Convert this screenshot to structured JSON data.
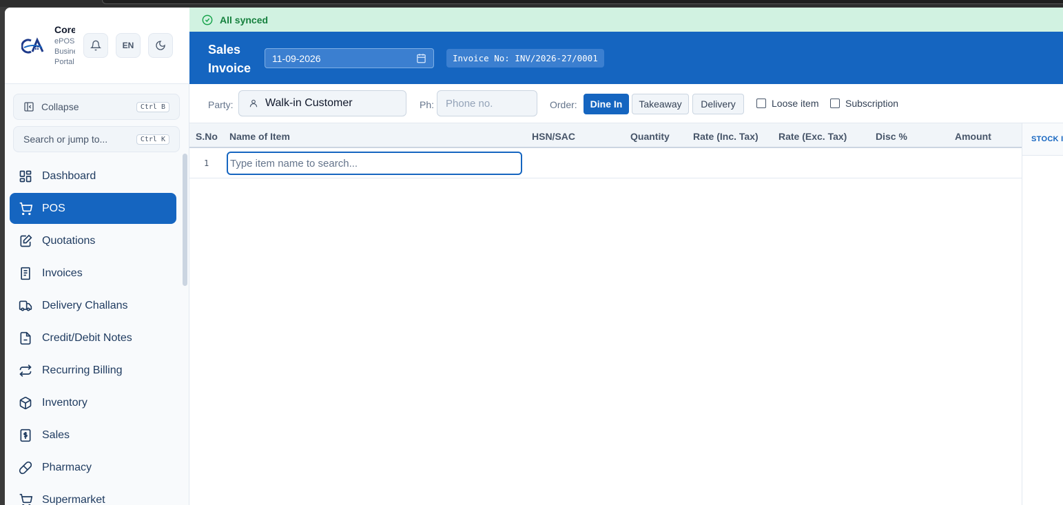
{
  "brand": {
    "name": "Core",
    "sub": [
      "ePOS",
      "Business",
      "Portal"
    ]
  },
  "header_buttons": {
    "bell": "bell-icon",
    "lang": "EN",
    "theme": "moon-icon"
  },
  "sidebar": {
    "collapse_label": "Collapse",
    "collapse_kbd": "Ctrl B",
    "search_label": "Search or jump to...",
    "search_kbd": "Ctrl K",
    "items": [
      {
        "label": "Dashboard",
        "icon": "grid-icon"
      },
      {
        "label": "POS",
        "icon": "cart-icon",
        "active": true
      },
      {
        "label": "Quotations",
        "icon": "edit-document-icon"
      },
      {
        "label": "Invoices",
        "icon": "receipt-icon"
      },
      {
        "label": "Delivery Challans",
        "icon": "truck-icon"
      },
      {
        "label": "Credit/Debit Notes",
        "icon": "note-icon"
      },
      {
        "label": "Recurring Billing",
        "icon": "repeat-icon"
      },
      {
        "label": "Inventory",
        "icon": "box-icon"
      },
      {
        "label": "Sales",
        "icon": "dollar-icon"
      },
      {
        "label": "Pharmacy",
        "icon": "pill-icon"
      },
      {
        "label": "Supermarket",
        "icon": "cart-icon"
      }
    ]
  },
  "sync_status": "All synced",
  "invoice": {
    "title_line1": "Sales",
    "title_line2": "Invoice",
    "date": "11-09-2026",
    "number": "Invoice No: INV/2026-27/0001"
  },
  "party_bar": {
    "party_label": "Party:",
    "party_value": "Walk-in Customer",
    "phone_label": "Ph:",
    "phone_placeholder": "Phone no.",
    "order_label": "Order:",
    "order_options": [
      "Dine In",
      "Takeaway",
      "Delivery"
    ],
    "order_selected": "Dine In",
    "loose_item": "Loose item",
    "subscription": "Subscription"
  },
  "table": {
    "columns": [
      "S.No",
      "Name of Item",
      "HSN/SAC",
      "Quantity",
      "Rate (Inc. Tax)",
      "Rate (Exc. Tax)",
      "Disc %",
      "Amount"
    ],
    "rows": [
      {
        "sno": "1"
      }
    ],
    "item_placeholder": "Type item name to search..."
  },
  "right_panel": {
    "header": "STOCK ITEMS"
  },
  "colors": {
    "primary": "#1565c0",
    "sync_bg": "#d1f2e1",
    "sync_text": "#15803d"
  }
}
